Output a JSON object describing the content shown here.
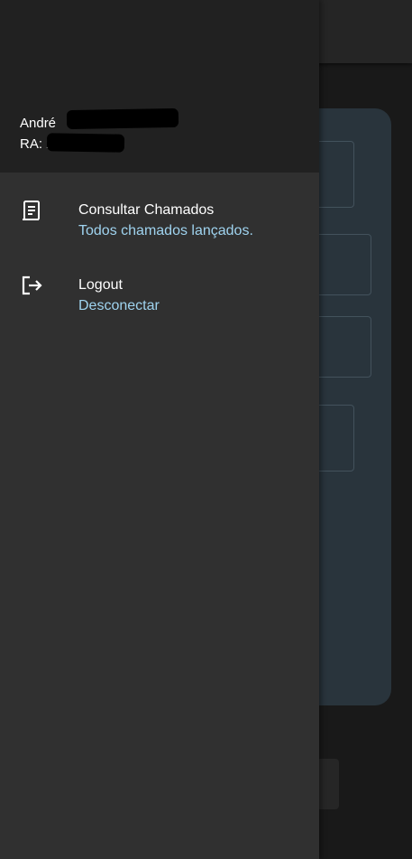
{
  "drawer": {
    "header": {
      "user_name": "André",
      "user_ra": "RA: 2"
    },
    "items": [
      {
        "title": "Consultar Chamados",
        "subtitle": "Todos chamados lançados.",
        "icon": "receipt-icon"
      },
      {
        "title": "Logout",
        "subtitle": "Desconectar",
        "icon": "logout-icon"
      }
    ]
  },
  "colors": {
    "drawer_background": "#303030",
    "header_background": "#212121",
    "subtitle_text": "#9fd3ef",
    "title_text": "#ffffff",
    "background_card": "#29343c"
  }
}
